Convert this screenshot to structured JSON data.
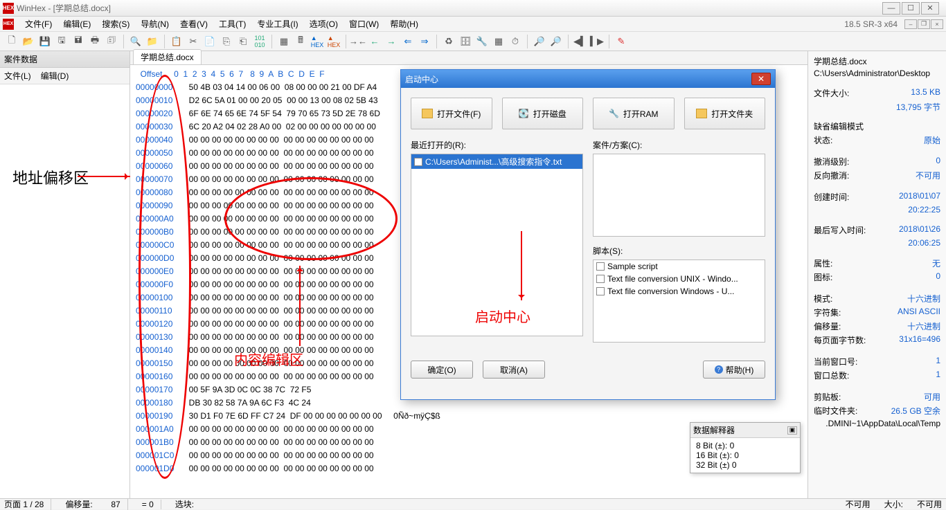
{
  "title": "WinHex - [学期总结.docx]",
  "version": "18.5 SR-3 x64",
  "menus": [
    "文件(F)",
    "编辑(E)",
    "搜索(S)",
    "导航(N)",
    "查看(V)",
    "工具(T)",
    "专业工具(I)",
    "选项(O)",
    "窗口(W)",
    "帮助(H)"
  ],
  "sidebar": {
    "header": "案件数据",
    "menu": [
      "文件(L)",
      "编辑(D)"
    ]
  },
  "tab": "学期总结.docx",
  "hexheader": "Offset     0  1  2  3  4  5  6  7   8  9  A  B  C  D  E  F",
  "rows": [
    {
      "off": "00000000",
      "b": "50 4B 03 04 14 00 06 00  08 00 00 00 21 00 DF A4"
    },
    {
      "off": "00000010",
      "b": "D2 6C 5A 01 00 00 20 05  00 00 13 00 08 02 5B 43"
    },
    {
      "off": "00000020",
      "b": "6F 6E 74 65 6E 74 5F 54  79 70 65 73 5D 2E 78 6D"
    },
    {
      "off": "00000030",
      "b": "6C 20 A2 04 02 28 A0 00  02 00 00 00 00 00 00 00"
    },
    {
      "off": "00000040",
      "b": "00 00 00 00 00 00 00 00  00 00 00 00 00 00 00 00"
    },
    {
      "off": "00000050",
      "b": "00 00 00 00 00 00 00 00  00 00 00 00 00 00 00 00"
    },
    {
      "off": "00000060",
      "b": "00 00 00 00 00 00 00 00  00 00 00 00 00 00 00 00"
    },
    {
      "off": "00000070",
      "b": "00 00 00 00 00 00 00 00  00 00 00 00 00 00 00 00"
    },
    {
      "off": "00000080",
      "b": "00 00 00 00 00 00 00 00  00 00 00 00 00 00 00 00"
    },
    {
      "off": "00000090",
      "b": "00 00 00 00 00 00 00 00  00 00 00 00 00 00 00 00"
    },
    {
      "off": "000000A0",
      "b": "00 00 00 00 00 00 00 00  00 00 00 00 00 00 00 00"
    },
    {
      "off": "000000B0",
      "b": "00 00 00 00 00 00 00 00  00 00 00 00 00 00 00 00"
    },
    {
      "off": "000000C0",
      "b": "00 00 00 00 00 00 00 00  00 00 00 00 00 00 00 00"
    },
    {
      "off": "000000D0",
      "b": "00 00 00 00 00 00 00 00  00 00 00 00 00 00 00 00"
    },
    {
      "off": "000000E0",
      "b": "00 00 00 00 00 00 00 00  00 00 00 00 00 00 00 00"
    },
    {
      "off": "000000F0",
      "b": "00 00 00 00 00 00 00 00  00 00 00 00 00 00 00 00"
    },
    {
      "off": "00000100",
      "b": "00 00 00 00 00 00 00 00  00 00 00 00 00 00 00 00"
    },
    {
      "off": "00000110",
      "b": "00 00 00 00 00 00 00 00  00 00 00 00 00 00 00 00"
    },
    {
      "off": "00000120",
      "b": "00 00 00 00 00 00 00 00  00 00 00 00 00 00 00 00"
    },
    {
      "off": "00000130",
      "b": "00 00 00 00 00 00 00 00  00 00 00 00 00 00 00 00"
    },
    {
      "off": "00000140",
      "b": "00 00 00 00 00 00 00 00  00 00 00 00 00 00 00 00"
    },
    {
      "off": "00000150",
      "b": "00 00 00 00 00 00 00 00  00 00 00 00 00 00 00 00"
    },
    {
      "off": "00000160",
      "b": "00 00 00 00 00 00 00 00  00 00 00 00 00 00 00 00"
    },
    {
      "off": "00000170",
      "b": "00 5F 9A 3D 0C 0C 38 7C  72 F5"
    },
    {
      "off": "00000180",
      "b": "DB 30 82 58 7A 9A 6C F3  4C 24"
    },
    {
      "off": "00000190",
      "b": "30 D1 F0 7E 6D FF C7 24  DF 00 00 00 00 00 00 00",
      "t": "  0Ñð~mÿÇ$ß"
    },
    {
      "off": "000001A0",
      "b": "00 00 00 00 00 00 00 00  00 00 00 00 00 00 00 00"
    },
    {
      "off": "000001B0",
      "b": "00 00 00 00 00 00 00 00  00 00 00 00 00 00 00 00"
    },
    {
      "off": "000001C0",
      "b": "00 00 00 00 00 00 00 00  00 00 00 00 00 00 00 00"
    },
    {
      "off": "000001D0",
      "b": "00 00 00 00 00 00 00 00  00 00 00 00 00 00 00 00"
    }
  ],
  "dialog": {
    "title": "启动中心",
    "openButtons": [
      "打开文件(F)",
      "打开磁盘",
      "打开RAM",
      "打开文件夹"
    ],
    "recentLabel": "最近打开的(R):",
    "recentItems": [
      "C:\\Users\\Administ...\\高级搜索指令.txt"
    ],
    "caseLabel": "案件/方案(C):",
    "scriptLabel": "脚本(S):",
    "scripts": [
      "Sample script",
      "Text file conversion UNIX - Windo...",
      "Text file conversion Windows - U..."
    ],
    "ok": "确定(O)",
    "cancel": "取消(A)",
    "help": "帮助(H)"
  },
  "props": {
    "filename": "学期总结.docx",
    "path": "C:\\Users\\Administrator\\Desktop",
    "sizeLabel": "文件大小:",
    "size": "13.5 KB",
    "bytes": "13,795 字节",
    "modeLabel": "缺省编辑模式",
    "stateLabel": "状态:",
    "state": "原始",
    "undoLabel": "撤消级别:",
    "undo": "0",
    "revLabel": "反向撤消:",
    "rev": "不可用",
    "createdLabel": "创建时间:",
    "created": "2018\\01\\07",
    "createdTime": "20:22:25",
    "modLabel": "最后写入时间:",
    "mod": "2018\\01\\26",
    "modTime": "20:06:25",
    "attrLabel": "属性:",
    "attr": "无",
    "iconLabel": "图标:",
    "icon": "0",
    "modeLabel2": "模式:",
    "mode2": "十六进制",
    "charsetLabel": "字符集:",
    "charset": "ANSI ASCII",
    "offLabel": "偏移量:",
    "off": "十六进制",
    "bplLabel": "每页面字节数:",
    "bpl": "31x16=496",
    "winLabel": "当前窗口号:",
    "win": "1",
    "totwinLabel": "窗口总数:",
    "totwin": "1",
    "clipLabel": "剪贴板:",
    "clip": "可用",
    "tmpLabel": "临时文件夹:",
    "tmp": "26.5 GB 空余",
    "tmpPath": ".DMINI~1\\AppData\\Local\\Temp"
  },
  "datainterp": {
    "title": "数据解释器",
    "l1": "8 Bit (±): 0",
    "l2": "16 Bit (±): 0",
    "l3": "32 Bit (±) 0"
  },
  "status": {
    "page": "页面 1 / 28",
    "offlbl": "偏移量:",
    "off": "87",
    "eq": "= 0",
    "sel": "选块:",
    "na": "不可用",
    "sizelbl": "大小:",
    "na2": "不可用"
  },
  "annotations": {
    "addr": "地址偏移区",
    "content": "内容编辑区",
    "start": "启动中心"
  }
}
